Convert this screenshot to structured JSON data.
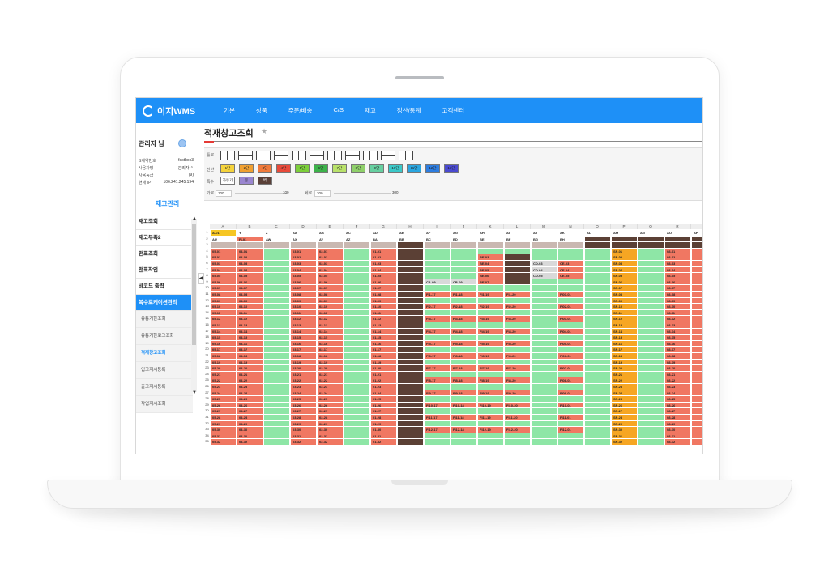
{
  "app": {
    "logo_text": "이지WMS",
    "nav": [
      "기본",
      "상품",
      "주문/배송",
      "C/S",
      "재고",
      "정산/통계",
      "고객센터"
    ]
  },
  "sidebar": {
    "admin_label": "관리자 님",
    "info": [
      {
        "label": "S계약번호",
        "value": "fastbox3"
      },
      {
        "label": "사용자명",
        "value": "관리자 ⌃"
      },
      {
        "label": "사용등급",
        "value": "(9)"
      },
      {
        "label": "현재 IP",
        "value": "106.241.245.194"
      }
    ],
    "section_title": "재고관리",
    "menu": [
      "재고조회",
      "재고부족2",
      "전표조회",
      "전표작업",
      "바코드 출력",
      "복수로케이션관리"
    ],
    "submenu": [
      "유통기한조회",
      "유통기한로그조회",
      "적재창고조회",
      "입고지시등록",
      "출고지시등록",
      "작업지시조회"
    ],
    "current_submenu": "적재창고조회"
  },
  "page": {
    "title": "적재창고조회"
  },
  "toolbox": {
    "shape_label": "틀로",
    "tier_label": "선반",
    "etc_label": "특수",
    "tiers": [
      "1단",
      "2단",
      "3단",
      "4단",
      "5단",
      "6단",
      "7단",
      "8단",
      "9단",
      "10단",
      "11단",
      "12단",
      "13단"
    ],
    "tier_colors": [
      "#f5d33b",
      "#f0a030",
      "#f07a3a",
      "#e84a3a",
      "#7ccf3a",
      "#3db24a",
      "#b9e26a",
      "#8fd06a",
      "#66cfa0",
      "#3bc8c8",
      "#2aa6e0",
      "#2d7de0",
      "#4a4ad0"
    ],
    "etc_items": [
      "자유기",
      "문",
      "벽"
    ],
    "etc_colors": [
      "#ffffff",
      "#9a86d0",
      "#5a4038"
    ],
    "width_label": "가로",
    "width_value": "100",
    "width_slider_value": "100",
    "height_label": "세로",
    "height_value": "300",
    "height_slider_value": "300"
  },
  "grid": {
    "columns": [
      "A",
      "B",
      "C",
      "D",
      "E",
      "F",
      "G",
      "H",
      "I",
      "J",
      "K",
      "L",
      "M",
      "N",
      "O",
      "P",
      "Q",
      "R",
      "S"
    ],
    "header_row1": [
      "A-01",
      "",
      "",
      "",
      "",
      "",
      "",
      "",
      "",
      "",
      "",
      "",
      "",
      "",
      "",
      "",
      "",
      "",
      ""
    ],
    "header_row2": [
      "AU",
      "AV",
      "AW",
      "AX",
      "AY",
      "AZ",
      "BA",
      "BB",
      "BC",
      "BD",
      "BE",
      "BF",
      "BG",
      "BH",
      "",
      "",
      "",
      "",
      ""
    ],
    "header_row2_top": [
      "",
      "Y",
      "Z",
      "AA",
      "AB",
      "AC",
      "AD",
      "AE",
      "AF",
      "AG",
      "AH",
      "AI",
      "AJ",
      "AK",
      "AL",
      "AM",
      "AN",
      "AO",
      "AP"
    ],
    "red_label": "FI-01",
    "rows": [
      "05-01",
      "05-02",
      "05-03",
      "05-04",
      "05-05",
      "05-06",
      "05-07",
      "05-08",
      "05-09",
      "05-10",
      "05-11",
      "05-12",
      "05-13",
      "05-14",
      "05-15",
      "05-16",
      "05-17",
      "05-18",
      "05-19",
      "05-20",
      "05-21",
      "05-22",
      "05-23",
      "05-24",
      "05-25",
      "05-26",
      "05-27",
      "05-28",
      "05-29",
      "05-30",
      "05-31",
      "05-32"
    ],
    "col_b_prefix": "04",
    "col_d_prefix": "03",
    "col_e_prefix": "02",
    "col_g_prefix": "01",
    "col_r_prefix": "08",
    "sp_prefix": "SP",
    "i_labels": [
      "FI1-17",
      "FI2-17",
      "FI3-17",
      "FI4-17",
      "FI5-17",
      "FI6-17",
      "FI7-17",
      "FI8-17",
      "FI9-17",
      "FI10-17",
      "FI11-17",
      "FI12-17"
    ],
    "j_labels": [
      "FI1-18",
      "FI2-18",
      "FI3-18",
      "FI4-18",
      "FI5-18",
      "FI6-18",
      "FI7-18",
      "FI8-18",
      "FI9-18",
      "FI10-18",
      "FI11-18",
      "FI12-18"
    ],
    "k_labels": [
      "FI1-19",
      "FI2-19",
      "FI3-19",
      "FI4-19",
      "FI5-19",
      "FI6-19",
      "FI7-19",
      "FI8-19",
      "FI9-19",
      "FI10-19",
      "FI11-19",
      "FI12-19"
    ],
    "l_labels": [
      "FI1-20",
      "FI2-20",
      "FI3-20",
      "FI4-20",
      "FI5-20",
      "FI6-20",
      "FI7-20",
      "FI8-20",
      "FI9-20",
      "FI10-20",
      "FI11-20",
      "FI12-20"
    ],
    "n_labels": [
      "FI01-01",
      "FI02-01",
      "FI03-01",
      "FI04-01",
      "FI05-01",
      "FI06-01",
      "FI07-01",
      "FI08-01",
      "FI09-01",
      "FI10-01",
      "FI11-01",
      "FI12-01"
    ],
    "k_top": [
      "BE-03",
      "BE-04",
      "BE-05",
      "BE-06",
      "BE-07"
    ],
    "j_top": [
      "CA-09",
      "CB-09"
    ],
    "m_top": [
      "CD-03",
      "CD-04",
      "CD-05"
    ],
    "n_top": [
      "CE-03",
      "CE-04",
      "CE-05"
    ]
  }
}
